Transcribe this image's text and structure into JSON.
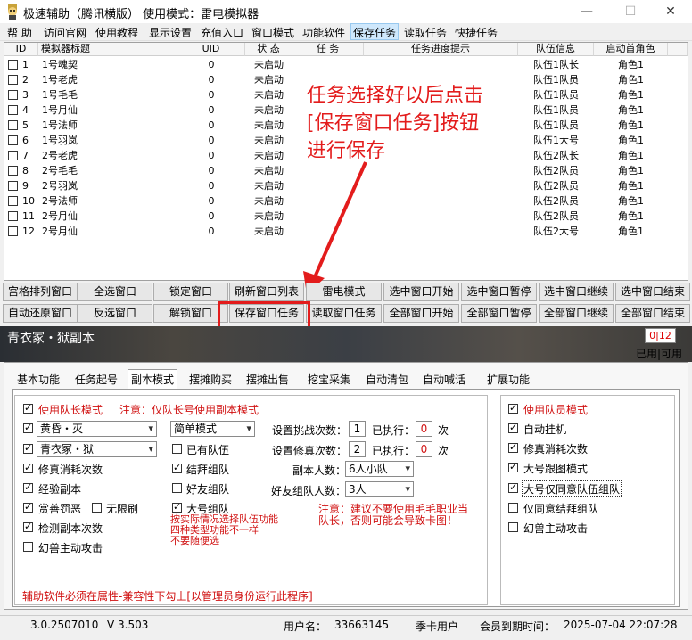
{
  "window": {
    "title": "极速辅助（腾讯横版）   使用模式：雷电模拟器",
    "minimize": "—",
    "maximize": "☐",
    "close": "✕"
  },
  "menu": [
    "帮 助",
    "访问官网",
    "使用教程",
    "显示设置",
    "充值入口",
    "窗口模式",
    "功能软件",
    "保存任务",
    "读取任务",
    "快捷任务"
  ],
  "grid": {
    "headers": [
      "ID",
      "模拟器标题",
      "UID",
      "状 态",
      "任 务",
      "任务进度提示",
      "队伍信息",
      "启动首角色"
    ],
    "rows": [
      {
        "id": "1",
        "title": "1号魂契",
        "uid": "0",
        "status": "未启动",
        "team": "队伍1队长",
        "role": "角色1"
      },
      {
        "id": "2",
        "title": "1号老虎",
        "uid": "0",
        "status": "未启动",
        "team": "队伍1队员",
        "role": "角色1"
      },
      {
        "id": "3",
        "title": "1号毛毛",
        "uid": "0",
        "status": "未启动",
        "team": "队伍1队员",
        "role": "角色1"
      },
      {
        "id": "4",
        "title": "1号月仙",
        "uid": "0",
        "status": "未启动",
        "team": "队伍1队员",
        "role": "角色1"
      },
      {
        "id": "5",
        "title": "1号法师",
        "uid": "0",
        "status": "未启动",
        "team": "队伍1队员",
        "role": "角色1"
      },
      {
        "id": "6",
        "title": "1号羽岚",
        "uid": "0",
        "status": "未启动",
        "team": "队伍1大号",
        "role": "角色1"
      },
      {
        "id": "7",
        "title": "2号老虎",
        "uid": "0",
        "status": "未启动",
        "team": "队伍2队长",
        "role": "角色1"
      },
      {
        "id": "8",
        "title": "2号毛毛",
        "uid": "0",
        "status": "未启动",
        "team": "队伍2队员",
        "role": "角色1"
      },
      {
        "id": "9",
        "title": "2号羽岚",
        "uid": "0",
        "status": "未启动",
        "team": "队伍2队员",
        "role": "角色1"
      },
      {
        "id": "10",
        "title": "2号法师",
        "uid": "0",
        "status": "未启动",
        "team": "队伍2队员",
        "role": "角色1"
      },
      {
        "id": "11",
        "title": "2号月仙",
        "uid": "0",
        "status": "未启动",
        "team": "队伍2队员",
        "role": "角色1"
      },
      {
        "id": "12",
        "title": "2号月仙",
        "uid": "0",
        "status": "未启动",
        "team": "队伍2大号",
        "role": "角色1"
      }
    ]
  },
  "annotation": {
    "line1": "任务选择好以后点击",
    "line2": "[保存窗口任务]按钮",
    "line3": "进行保存",
    "color": "#e31c1c"
  },
  "buttons": {
    "row1": [
      "宫格排列窗口",
      "全选窗口",
      "锁定窗口",
      "刷新窗口列表",
      "雷电模式",
      "选中窗口开始",
      "选中窗口暂停",
      "选中窗口继续",
      "选中窗口结束"
    ],
    "row2": [
      "自动还原窗口",
      "反选窗口",
      "解锁窗口",
      "保存窗口任务",
      "读取窗口任务",
      "全部窗口开始",
      "全部窗口暂停",
      "全部窗口继续",
      "全部窗口结束"
    ]
  },
  "banner": {
    "title": "青衣冢・狱副本",
    "counter": "0|12",
    "counter_label": "已用|可用"
  },
  "tabs": [
    "基本功能",
    "任务起号",
    "副本模式",
    "摆摊购买",
    "摆摊出售",
    "挖宝采集",
    "自动清包",
    "自动喊话",
    "扩展功能"
  ],
  "left": {
    "leader_mode": "使用队长模式",
    "leader_note": "注意：仅队长号使用副本模式",
    "sel_time": "黄昏・灭",
    "sel_mode": "简单模式",
    "sel_dungeon": "青衣冢・狱",
    "has_team": "已有队伍",
    "repair": "修真消耗次数",
    "bond": "结拜组队",
    "exp": "经验副本",
    "friend": "好友组队",
    "reward": "赏善罚恶",
    "unlimited": "无限刷",
    "big_team": "大号组队",
    "check": "检测副本次数",
    "beast": "幻兽主动攻击",
    "challenge_label": "设置挑战次数：",
    "challenge_val": "1",
    "done1_label": "已执行：",
    "done1_val": "0",
    "times1": "次",
    "repair_label": "设置修真次数：",
    "repair_val": "2",
    "done2_label": "已执行：",
    "done2_val": "0",
    "times2": "次",
    "size_label": "副本人数：",
    "size_val": "6人小队",
    "friend_size_label": "好友组队人数：",
    "friend_size_val": "3人",
    "note2a": "注意：建议不要使用毛毛职业当",
    "note2b": "队长，否则可能会导致卡图！",
    "note3a": "按实际情况选择队伍功能",
    "note3b": "四种类型功能不一样",
    "note3c": "不要随便选",
    "bottom_note": "辅助软件必须在属性-兼容性下勾上[以管理员身份运行此程序]"
  },
  "right": {
    "member_mode": "使用队员模式",
    "auto_hang": "自动挂机",
    "repair": "修真消耗次数",
    "follow": "大号跟图模式",
    "agree": "大号仅同意队伍组队",
    "agree_bond": "仅同意结拜组队",
    "beast": "幻兽主动攻击"
  },
  "status": {
    "version": "3.0.2507010",
    "v": "V 3.503",
    "user_label": "用户名：",
    "user": "33663145",
    "card": "季卡用户",
    "expire_label": "会员到期时间：",
    "expire": "2025-07-04  22:07:28"
  }
}
